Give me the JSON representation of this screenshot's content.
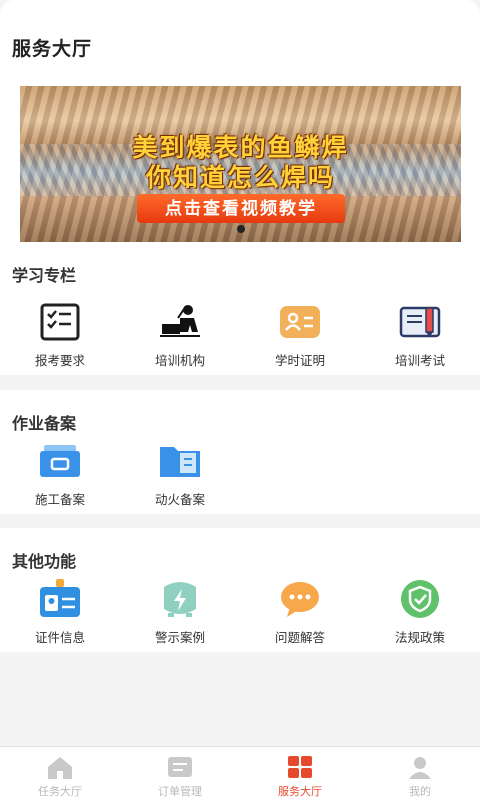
{
  "page": {
    "title": "服务大厅"
  },
  "banner": {
    "line1": "美到爆表的鱼鳞焊",
    "line2": "你知道怎么焊吗",
    "cta": "点击查看视频教学"
  },
  "sections": {
    "study": {
      "title": "学习专栏",
      "items": [
        {
          "label": "报考要求",
          "icon": "checklist-icon"
        },
        {
          "label": "培训机构",
          "icon": "trainer-icon"
        },
        {
          "label": "学时证明",
          "icon": "id-card-icon"
        },
        {
          "label": "培训考试",
          "icon": "exam-book-icon"
        }
      ]
    },
    "work": {
      "title": "作业备案",
      "items": [
        {
          "label": "施工备案",
          "icon": "folder-box-icon"
        },
        {
          "label": "动火备案",
          "icon": "folder-doc-icon"
        }
      ]
    },
    "other": {
      "title": "其他功能",
      "items": [
        {
          "label": "证件信息",
          "icon": "badge-icon"
        },
        {
          "label": "警示案例",
          "icon": "warning-case-icon"
        },
        {
          "label": "问题解答",
          "icon": "chat-bubble-icon"
        },
        {
          "label": "法规政策",
          "icon": "shield-icon"
        }
      ]
    }
  },
  "tabbar": {
    "active": "服务大厅",
    "tabs": [
      {
        "label": "任务大厅",
        "icon": "home-icon"
      },
      {
        "label": "订单管理",
        "icon": "order-icon"
      },
      {
        "label": "服务大厅",
        "icon": "grid-icon"
      },
      {
        "label": "我的",
        "icon": "user-icon"
      }
    ]
  },
  "colors": {
    "accent": "#e64a2e",
    "inactive": "#b8b8b8"
  }
}
